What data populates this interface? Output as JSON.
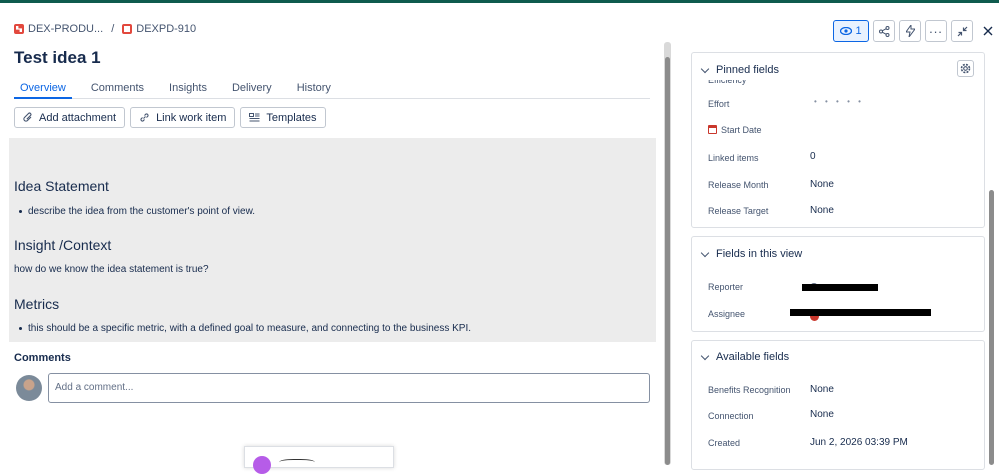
{
  "breadcrumb": {
    "project": "DEX-PRODU...",
    "separator": "/",
    "key": "DEXPD-910"
  },
  "header": {
    "watch_count": "1",
    "share_icon": "share-icon",
    "lightning_icon": "lightning-icon",
    "more_icon": "more-icon",
    "collapse_icon": "collapse-icon",
    "close_icon": "close-icon"
  },
  "title": "Test idea 1",
  "tabs": [
    {
      "label": "Overview",
      "active": true
    },
    {
      "label": "Comments",
      "active": false
    },
    {
      "label": "Insights",
      "active": false
    },
    {
      "label": "Delivery",
      "active": false
    },
    {
      "label": "History",
      "active": false
    }
  ],
  "actions": {
    "attachment": "Add attachment",
    "link": "Link work item",
    "templates": "Templates"
  },
  "description": {
    "h1": "Idea Statement",
    "b1": "describe the idea from the customer's point of view.",
    "h2": "Insight /Context",
    "p2": "how do we know the idea statement is true?",
    "h3": "Metrics",
    "b3": "this should be a specific metric, with a defined goal to measure, and connecting to the business KPI."
  },
  "comments": {
    "heading": "Comments",
    "placeholder": "Add a comment..."
  },
  "pinned": {
    "heading": "Pinned fields",
    "cut_label": "Efficiency",
    "effort_label": "Effort",
    "effort_value": "• • • • •",
    "start_label": "Start Date",
    "linked_label": "Linked items",
    "linked_value": "0",
    "release_month_label": "Release Month",
    "release_month_value": "None",
    "release_target_label": "Release Target",
    "release_target_value": "None"
  },
  "view_fields": {
    "heading": "Fields in this view",
    "reporter_label": "Reporter",
    "assignee_label": "Assignee"
  },
  "available": {
    "heading": "Available fields",
    "benefits_label": "Benefits Recognition",
    "benefits_value": "None",
    "connection_label": "Connection",
    "connection_value": "None",
    "created_label": "Created",
    "created_value": "Jun 2, 2026 03:39 PM"
  },
  "colors": {
    "accent": "#0c66e4",
    "topbar": "#0f5b4e",
    "brand_red": "#e2483d"
  }
}
